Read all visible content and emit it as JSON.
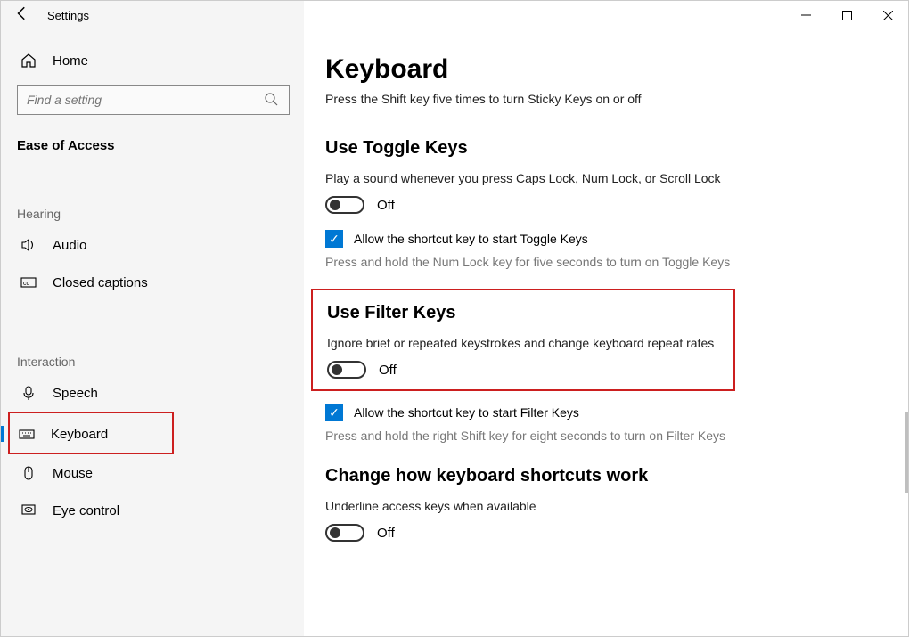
{
  "window": {
    "title": "Settings"
  },
  "sidebar": {
    "home": "Home",
    "search_placeholder": "Find a setting",
    "category": "Ease of Access",
    "hearing_label": "Hearing",
    "hearing_items": [
      {
        "label": "Audio"
      },
      {
        "label": "Closed captions"
      }
    ],
    "interaction_label": "Interaction",
    "interaction_items": [
      {
        "label": "Speech"
      },
      {
        "label": "Keyboard"
      },
      {
        "label": "Mouse"
      },
      {
        "label": "Eye control"
      }
    ]
  },
  "main": {
    "title": "Keyboard",
    "sticky_subtext": "Press the Shift key five times to turn Sticky Keys on or off",
    "toggle_keys_heading": "Use Toggle Keys",
    "toggle_keys_desc": "Play a sound whenever you press Caps Lock, Num Lock, or Scroll Lock",
    "toggle_keys_state": "Off",
    "toggle_keys_checkbox": "Allow the shortcut key to start Toggle Keys",
    "toggle_keys_hint": "Press and hold the Num Lock key for five seconds to turn on Toggle Keys",
    "filter_keys_heading": "Use Filter Keys",
    "filter_keys_desc": "Ignore brief or repeated keystrokes and change keyboard repeat rates",
    "filter_keys_state": "Off",
    "filter_keys_checkbox": "Allow the shortcut key to start Filter Keys",
    "filter_keys_hint": "Press and hold the right Shift key for eight seconds to turn on Filter Keys",
    "shortcuts_heading": "Change how keyboard shortcuts work",
    "shortcuts_desc": "Underline access keys when available",
    "shortcuts_state": "Off"
  }
}
